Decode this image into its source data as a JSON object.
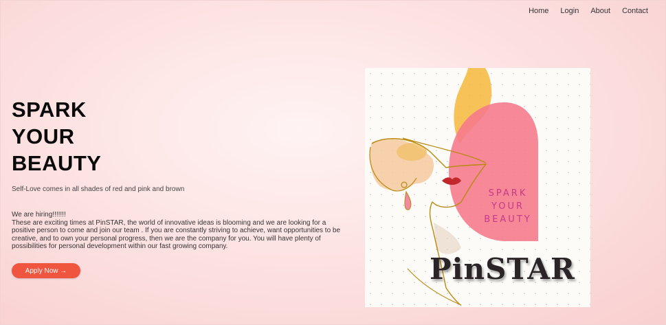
{
  "nav": {
    "items": [
      {
        "label": "Home"
      },
      {
        "label": "Login"
      },
      {
        "label": "About"
      },
      {
        "label": "Contact"
      }
    ]
  },
  "hero": {
    "title_lines": [
      "SPARK",
      "YOUR",
      "BEAUTY"
    ],
    "tagline": "Self-Love comes in all shades of red and pink and brown",
    "hiring_heading": "We are hiring!!!!!!!",
    "hiring_body": "These are exciting times at PinSTAR, the world of innovative ideas is blooming and we are looking for a positive person to come and join our team . If you are constantly striving to achieve, want opportunities to be creative, and to own your personal progress, then we are the company for you. You will have plenty of possibilities for personal development within our fast growing company.",
    "apply_label": "Apply Now →"
  },
  "poster": {
    "tag_lines": [
      "SPARK",
      "YOUR",
      "BEAUTY"
    ],
    "brand": "PinSTAR"
  },
  "colors": {
    "accent": "#f0553f",
    "poster_pink": "#c63a8a"
  }
}
